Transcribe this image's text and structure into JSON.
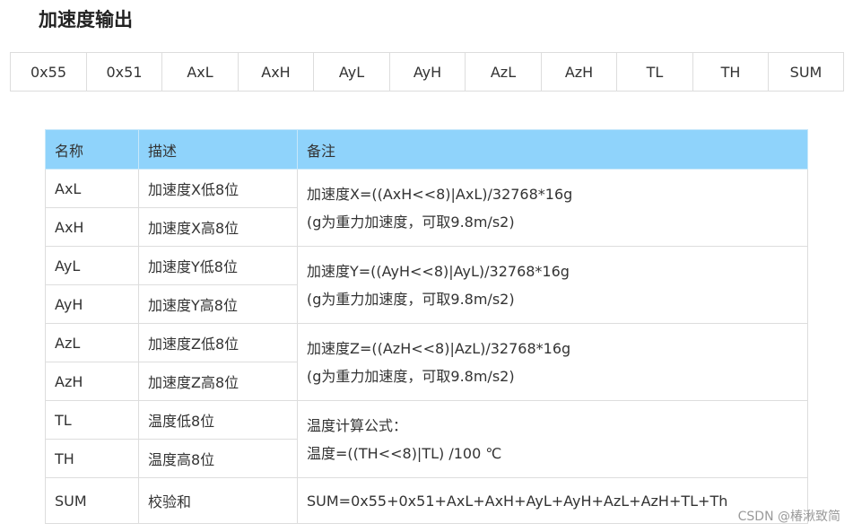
{
  "title": "加速度输出",
  "frame": {
    "cells": [
      "0x55",
      "0x51",
      "AxL",
      "AxH",
      "AyL",
      "AyH",
      "AzL",
      "AzH",
      "TL",
      "TH",
      "SUM"
    ]
  },
  "table": {
    "headers": [
      "名称",
      "描述",
      "备注"
    ],
    "rows": [
      {
        "name": "AxL",
        "desc": "加速度X低8位"
      },
      {
        "name": "AxH",
        "desc": "加速度X高8位"
      },
      {
        "name": "AyL",
        "desc": "加速度Y低8位"
      },
      {
        "name": "AyH",
        "desc": "加速度Y高8位"
      },
      {
        "name": "AzL",
        "desc": "加速度Z低8位"
      },
      {
        "name": "AzH",
        "desc": "加速度Z高8位"
      },
      {
        "name": "TL",
        "desc": "温度低8位"
      },
      {
        "name": "TH",
        "desc": "温度高8位"
      },
      {
        "name": "SUM",
        "desc": "校验和"
      }
    ],
    "notes": [
      [
        "加速度X=((AxH<<8)|AxL)/32768*16g",
        "(g为重力加速度，可取9.8m/s2)"
      ],
      [
        "加速度Y=((AyH<<8)|AyL)/32768*16g",
        "(g为重力加速度，可取9.8m/s2)"
      ],
      [
        "加速度Z=((AzH<<8)|AzL)/32768*16g",
        "(g为重力加速度，可取9.8m/s2)"
      ],
      [
        "温度计算公式：",
        "温度=((TH<<8)|TL) /100 ℃"
      ],
      [
        "SUM=0x55+0x51+AxL+AxH+AyL+AyH+AzL+AzH+TL+Th"
      ]
    ]
  },
  "watermark": "CSDN @椿湫致简"
}
